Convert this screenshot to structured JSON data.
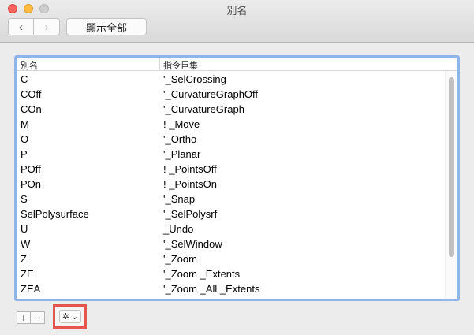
{
  "window": {
    "title": "別名",
    "show_all_label": "顯示全部",
    "back_icon": "‹",
    "forward_icon": "›"
  },
  "table": {
    "headers": [
      "別名",
      "指令巨集"
    ],
    "rows": [
      [
        "C",
        "'_SelCrossing"
      ],
      [
        "COff",
        "'_CurvatureGraphOff"
      ],
      [
        "COn",
        "'_CurvatureGraph"
      ],
      [
        "M",
        "! _Move"
      ],
      [
        "O",
        "'_Ortho"
      ],
      [
        "P",
        "'_Planar"
      ],
      [
        "POff",
        "! _PointsOff"
      ],
      [
        "POn",
        "! _PointsOn"
      ],
      [
        "S",
        "'_Snap"
      ],
      [
        "SelPolysurface",
        "'_SelPolysrf"
      ],
      [
        "U",
        "_Undo"
      ],
      [
        "W",
        "'_SelWindow"
      ],
      [
        "Z",
        "'_Zoom"
      ],
      [
        "ZE",
        "'_Zoom _Extents"
      ],
      [
        "ZEA",
        "'_Zoom _All _Extents"
      ]
    ]
  },
  "bottom": {
    "add_label": "+",
    "remove_label": "−",
    "gear_icon": "✲",
    "chevron": "⌄"
  },
  "colors": {
    "focus_ring": "#8fb5e8",
    "highlight_box": "#e1574f"
  }
}
